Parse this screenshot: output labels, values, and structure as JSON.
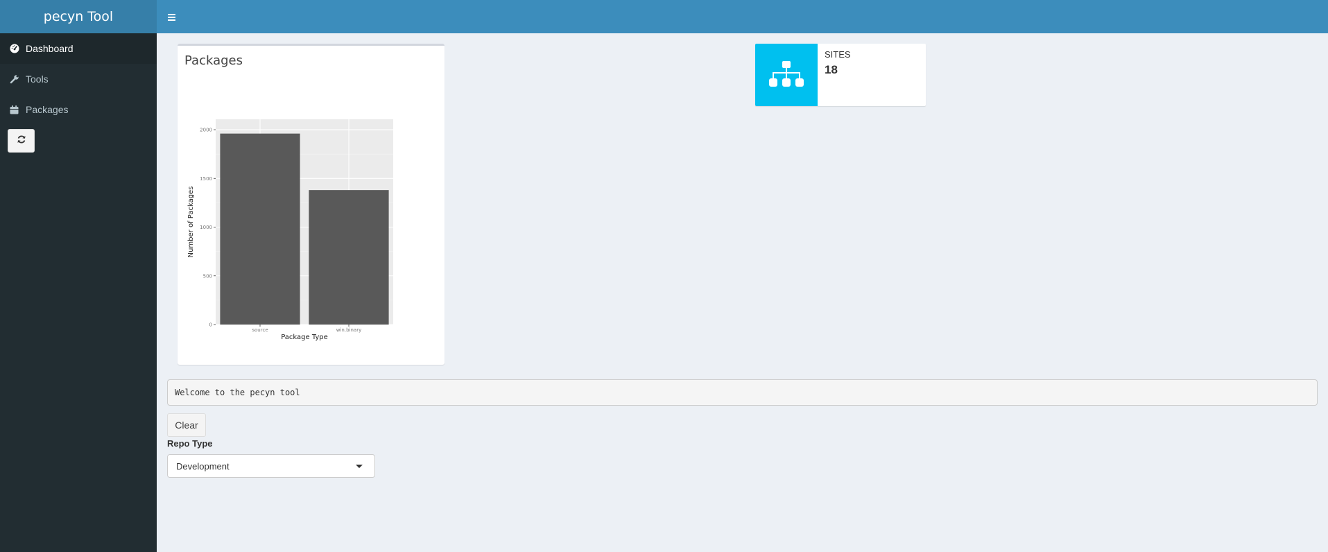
{
  "app": {
    "title": "pecyn Tool"
  },
  "sidebar": {
    "items": [
      {
        "label": "Dashboard",
        "icon": "dashboard-icon",
        "active": true
      },
      {
        "label": "Tools",
        "icon": "wrench-icon",
        "active": false
      },
      {
        "label": "Packages",
        "icon": "calendar-icon",
        "active": false
      }
    ],
    "refresh_icon": "refresh-icon"
  },
  "packages_box": {
    "title": "Packages"
  },
  "chart_data": {
    "type": "bar",
    "categories": [
      "source",
      "win.binary"
    ],
    "values": [
      1960,
      1380
    ],
    "xlabel": "Package Type",
    "ylabel": "Number of Packages",
    "ylim": [
      0,
      2050
    ],
    "yticks": [
      0,
      500,
      1000,
      1500,
      2000
    ],
    "grid": true,
    "bar_color": "#595959",
    "panel_color": "#ebebeb"
  },
  "sites_box": {
    "label": "SITES",
    "value": "18",
    "icon": "sitemap-icon",
    "color": "#00c0ef"
  },
  "console": {
    "text": "Welcome to the pecyn tool"
  },
  "clear_button": {
    "label": "Clear"
  },
  "repo_type": {
    "label": "Repo Type",
    "selected": "Development"
  },
  "colors": {
    "header": "#3c8dbc",
    "logo": "#367fa9",
    "sidebar": "#222d32",
    "background": "#ecf0f5"
  }
}
